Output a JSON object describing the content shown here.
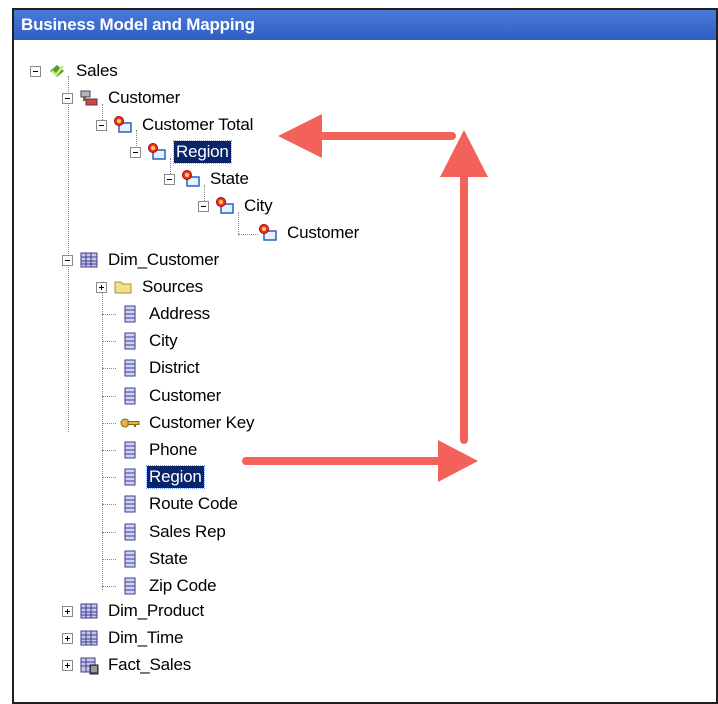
{
  "panel": {
    "title": "Business Model and Mapping"
  },
  "tree": {
    "sales": "Sales",
    "customer_dim": "Customer",
    "customer_total": "Customer Total",
    "region_level": "Region",
    "state_level": "State",
    "city_level": "City",
    "customer_level": "Customer",
    "dim_customer": "Dim_Customer",
    "sources": "Sources",
    "columns": [
      "Address",
      "City",
      "District",
      "Customer",
      "Customer Key",
      "Phone",
      "Region",
      "Route Code",
      "Sales Rep",
      "State",
      "Zip Code"
    ],
    "dim_product": "Dim_Product",
    "dim_time": "Dim_Time",
    "fact_sales": "Fact_Sales"
  },
  "colors": {
    "selection": "#0a246a",
    "arrow": "#f2625a",
    "title_bar": "#2f5ec4"
  }
}
